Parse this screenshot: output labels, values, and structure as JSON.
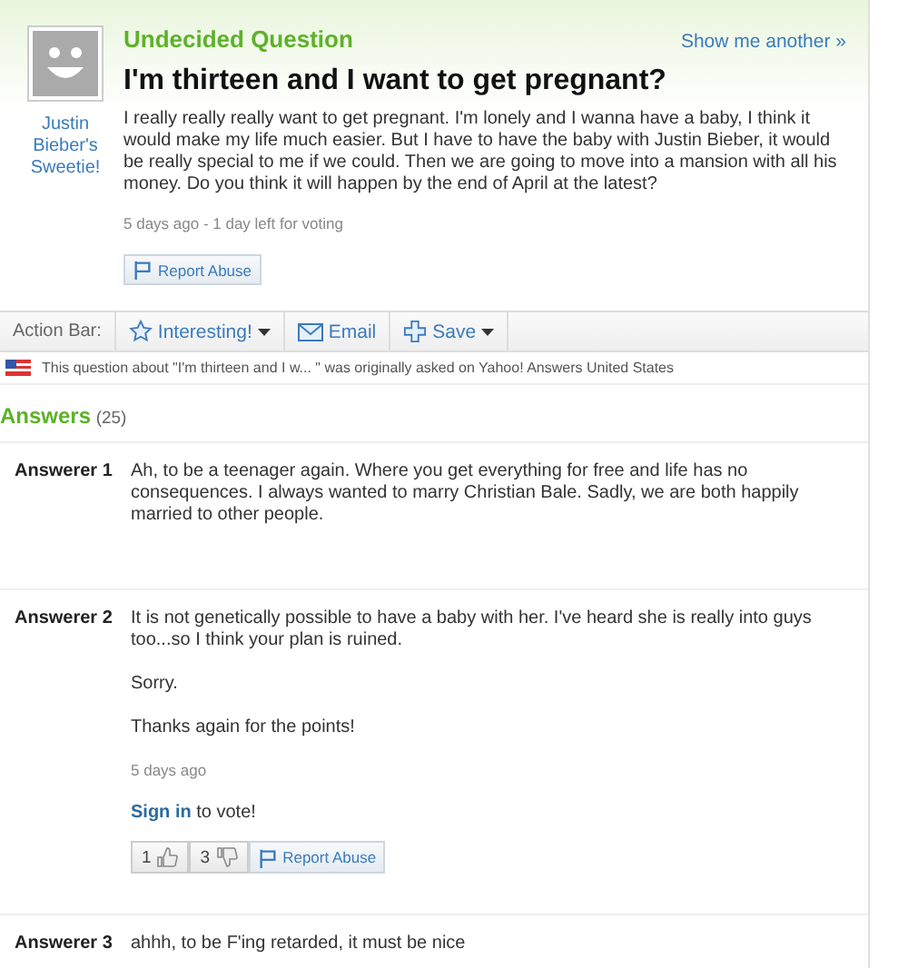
{
  "question": {
    "status": "Undecided Question",
    "show_another": "Show me another »",
    "asker": "Justin Bieber's Sweetie!",
    "title": "I'm thirteen and I want to get pregnant?",
    "body": "I really really really want to get pregnant. I'm lonely and I wanna have a baby, I think it would make my life much easier. But I have to have the baby with Justin Bieber, it would be really special to me if we could. Then we are going to move into a mansion with all his money. Do you think it will happen by the end of April at the latest?",
    "meta": "5 days ago - 1 day left for voting",
    "report": "Report Abuse"
  },
  "action_bar": {
    "label": "Action Bar:",
    "buttons": [
      {
        "kind": "star",
        "label": "Interesting!",
        "dropdown": true
      },
      {
        "kind": "mail",
        "label": "Email",
        "dropdown": false
      },
      {
        "kind": "plus",
        "label": "Save",
        "dropdown": true
      }
    ]
  },
  "origin_note": "This question about \"I'm thirteen and I w... \" was originally asked on Yahoo! Answers United States",
  "answers_heading": {
    "title": "Answers",
    "count": "(25)"
  },
  "answers": [
    {
      "author": "Answerer 1",
      "paragraphs": [
        "Ah, to be a teenager again. Where you get everything for free and life has no consequences. I always wanted to marry Christian Bale. Sadly, we are both happily married to other people."
      ]
    },
    {
      "author": "Answerer 2",
      "paragraphs": [
        "It is not genetically possible to have a baby with her. I've heard she is really into guys too...so I think your plan is ruined.",
        "Sorry.",
        "Thanks again for the points!"
      ],
      "time": "5 days ago",
      "sign_in": "Sign in",
      "sign_in_rest": "to vote!",
      "up": "1",
      "down": "3",
      "report": "Report Abuse"
    },
    {
      "author": "Answerer 3",
      "paragraphs": [
        "ahhh, to be F'ing retarded, it must be nice"
      ]
    }
  ]
}
